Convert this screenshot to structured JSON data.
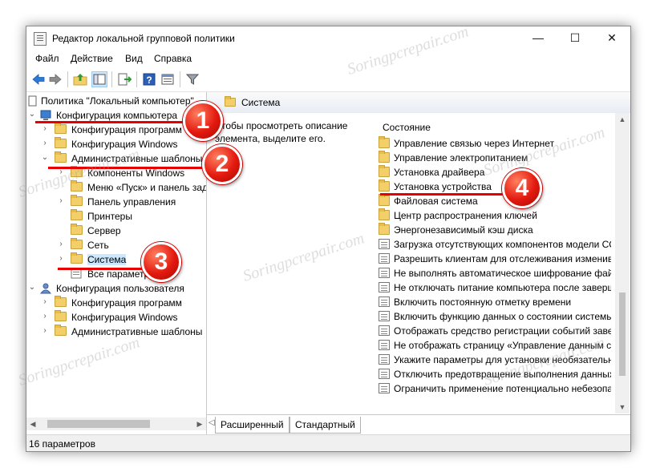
{
  "window": {
    "title": "Редактор локальной групповой политики",
    "controls": [
      "—",
      "☐",
      "✕"
    ]
  },
  "menu": [
    "Файл",
    "Действие",
    "Вид",
    "Справка"
  ],
  "toolbar_icons": [
    "back-arrow-icon",
    "forward-arrow-icon",
    "up-folder-icon",
    "show-tree-icon",
    "export-icon",
    "help-icon",
    "properties-icon",
    "filter-icon"
  ],
  "tree": {
    "root": "Политика \"Локальный компьютер\"",
    "items": [
      {
        "label": "Конфигурация компьютера"
      },
      {
        "label": "Конфигурация программ"
      },
      {
        "label": "Конфигурация Windows"
      },
      {
        "label": "Административные шаблоны"
      },
      {
        "label": "Компоненты Windows"
      },
      {
        "label": "Меню «Пуск» и панель задач"
      },
      {
        "label": "Панель управления"
      },
      {
        "label": "Принтеры"
      },
      {
        "label": "Сервер"
      },
      {
        "label": "Сеть"
      },
      {
        "label": "Система"
      },
      {
        "label": "Все параметры"
      },
      {
        "label": "Конфигурация пользователя"
      },
      {
        "label": "Конфигурация программ"
      },
      {
        "label": "Конфигурация Windows"
      },
      {
        "label": "Административные шаблоны"
      }
    ]
  },
  "details": {
    "header": "Система",
    "description": "Чтобы просмотреть описание элемента, выделите его.",
    "column": "Состояние",
    "items": [
      "Управление связью через Интернет",
      "Управление электропитанием",
      "Установка драйвера",
      "Установка устройства",
      "Файловая система",
      "Центр распространения ключей",
      "Энергонезависимый кэш диска",
      "Загрузка отсутствующих компонентов модели COM",
      "Разрешить клиентам для отслеживания изменивших",
      "Не выполнять автоматическое шифрование файлов",
      "Не отключать питание компьютера после завершения",
      "Включить постоянную отметку времени",
      "Включить функцию данных о состоянии системы",
      "Отображать средство регистрации событий завершения",
      "Не отображать страницу «Управление данным сервером»",
      "Укажите параметры для установки необязательных",
      "Отключить предотвращение выполнения данных",
      "Ограничить применение потенциально небезопасных"
    ],
    "tabs": [
      "Расширенный",
      "Стандартный"
    ]
  },
  "status": "16 параметров",
  "annotations": [
    "1",
    "2",
    "3",
    "4"
  ],
  "watermark": "Soringpcrepair.com",
  "colors": {
    "annotation_red": "#e60000",
    "folder": "#f3cf6a",
    "selection": "#cce8ff"
  }
}
